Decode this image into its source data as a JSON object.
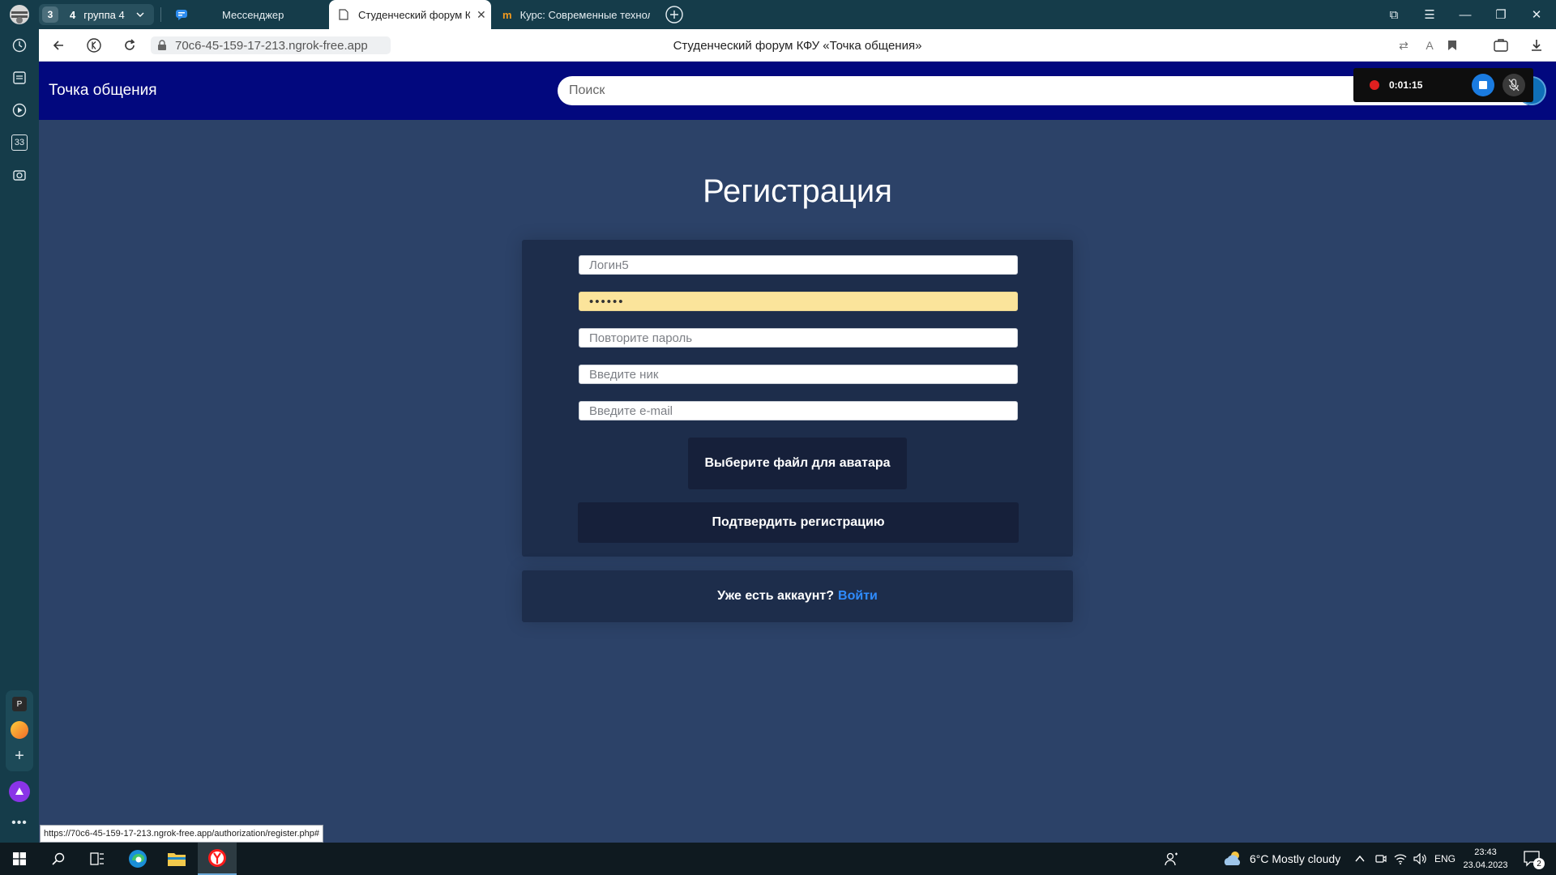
{
  "browser": {
    "tab_group": {
      "count": "3",
      "group_number": "4",
      "group_name": "группа 4"
    },
    "tabs": [
      {
        "title": "Мессенджер"
      },
      {
        "title": "Студенческий форум КФУ «Точка общения»"
      },
      {
        "title": "Курс: Современные технологии"
      }
    ],
    "url": "70c6-45-159-17-213.ngrok-free.app",
    "page_title": "Студенческий форум КФУ «Точка общения»",
    "status_url": "https://70c6-45-159-17-213.ngrok-free.app/authorization/register.php#"
  },
  "site": {
    "brand": "Точка общения",
    "search_placeholder": "Поиск"
  },
  "recording": {
    "time": "0:01:15"
  },
  "registration": {
    "title": "Регистрация",
    "login_placeholder": "Логин5",
    "password_value": "••••••",
    "repeat_password_placeholder": "Повторите пароль",
    "nick_placeholder": "Введите ник",
    "email_placeholder": "Введите e-mail",
    "avatar_button": "Выберите файл для аватара",
    "submit_button": "Подтвердить регистрацию",
    "have_account": "Уже есть аккаунт?",
    "login_link": "Войти"
  },
  "sidebar": {
    "counter_badge": "33",
    "panel_letter": "P"
  },
  "taskbar": {
    "weather": "6°C  Mostly cloudy",
    "language": "ENG",
    "time": "23:43",
    "date": "23.04.2023",
    "notifications": "2"
  },
  "colors": {
    "page_bg": "#2c4268",
    "header_bg": "#02087e",
    "card_bg": "#1d2d4b",
    "button_bg": "#16203a",
    "link": "#2f8cff",
    "autofill": "#fbe49b",
    "browser_chrome": "#153c4a"
  }
}
